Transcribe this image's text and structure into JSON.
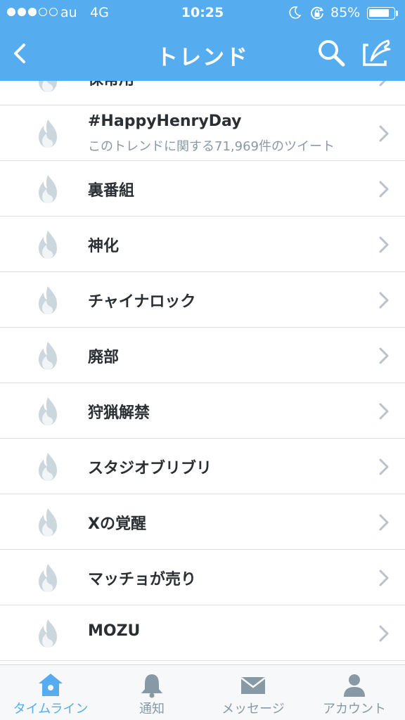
{
  "status_bar": {
    "carrier": "au",
    "network": "4G",
    "time": "10:25",
    "battery_text": "85%",
    "battery_level": 0.85,
    "signal_bars_filled": 3,
    "signal_bars_total": 5
  },
  "nav": {
    "title": "トレンド",
    "back_icon": "chevron-left-icon",
    "search_icon": "search-icon",
    "compose_icon": "compose-tweet-icon"
  },
  "trends": [
    {
      "label": "保常用"
    },
    {
      "label": "#HappyHenryDay",
      "subtitle": "このトレンドに関する71,969件のツイート"
    },
    {
      "label": "裏番組"
    },
    {
      "label": "神化"
    },
    {
      "label": "チャイナロック"
    },
    {
      "label": "廃部"
    },
    {
      "label": "狩猟解禁"
    },
    {
      "label": "スタジオブリブリ"
    },
    {
      "label": "Xの覚醒"
    },
    {
      "label": "マッチョが売り"
    },
    {
      "label": "MOZU"
    }
  ],
  "tabs": [
    {
      "label": "タイムライン",
      "icon": "home-icon",
      "active": true
    },
    {
      "label": "通知",
      "icon": "bell-icon",
      "active": false
    },
    {
      "label": "メッセージ",
      "icon": "envelope-icon",
      "active": false
    },
    {
      "label": "アカウント",
      "icon": "person-icon",
      "active": false
    }
  ],
  "colors": {
    "brand": "#55acee",
    "text_primary": "#292f33",
    "text_secondary": "#8899a6",
    "flame": "#ccd6dd",
    "chevron": "#b8c2cc"
  }
}
